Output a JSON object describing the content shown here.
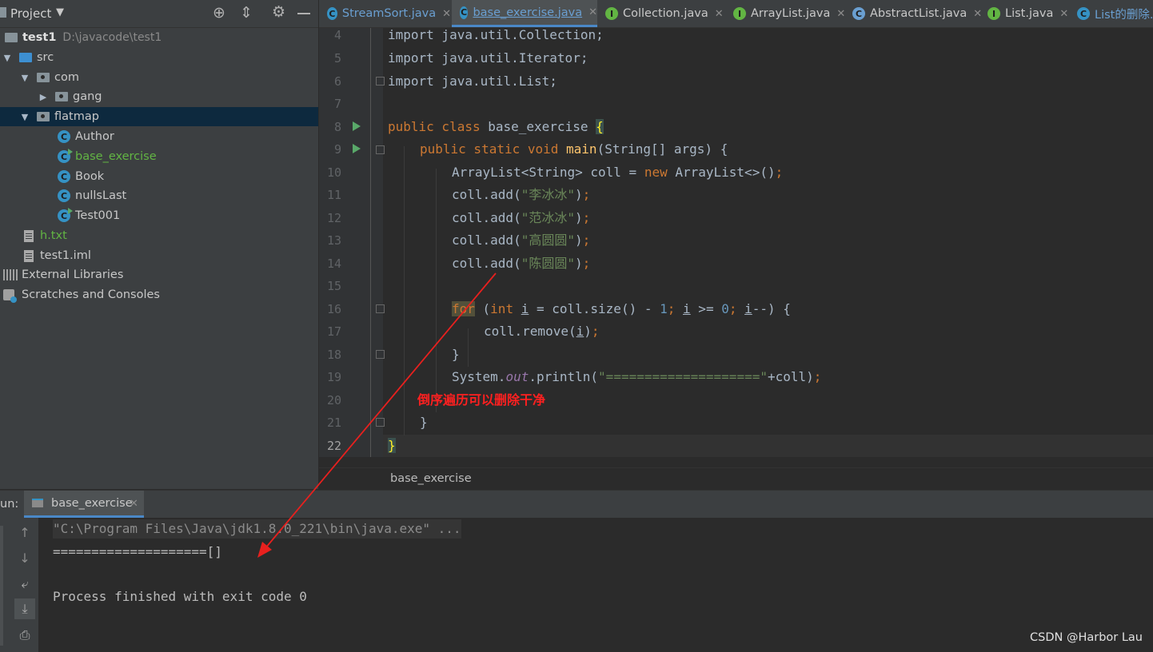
{
  "project_panel": {
    "title": "Project",
    "root": {
      "name": "test1",
      "path": "D:\\javacode\\test1"
    },
    "tree": [
      {
        "label": "src",
        "type": "src-folder",
        "depth": 1,
        "expanded": true
      },
      {
        "label": "com",
        "type": "package",
        "depth": 2,
        "expanded": true
      },
      {
        "label": "gang",
        "type": "package",
        "depth": 3,
        "expanded": false
      },
      {
        "label": "flatmap",
        "type": "package",
        "depth": 2,
        "expanded": true,
        "selected": true
      },
      {
        "label": "Author",
        "type": "class",
        "depth": 3
      },
      {
        "label": "base_exercise",
        "type": "class-run",
        "depth": 3,
        "modified": true
      },
      {
        "label": "Book",
        "type": "class",
        "depth": 3
      },
      {
        "label": "nullsLast",
        "type": "class",
        "depth": 3
      },
      {
        "label": "Test001",
        "type": "class-run",
        "depth": 3
      },
      {
        "label": "h.txt",
        "type": "file",
        "depth": 1,
        "modified": true
      },
      {
        "label": "test1.iml",
        "type": "file",
        "depth": 1
      },
      {
        "label": "External Libraries",
        "type": "libraries",
        "depth": 0
      },
      {
        "label": "Scratches and Consoles",
        "type": "scratches",
        "depth": 0
      }
    ]
  },
  "tabs": [
    {
      "label": "StreamSort.java",
      "icon": "class-icon"
    },
    {
      "label": "base_exercise.java",
      "icon": "class-icon",
      "active": true
    },
    {
      "label": "Collection.java",
      "icon": "interface-icon"
    },
    {
      "label": "ArrayList.java",
      "icon": "interface-icon"
    },
    {
      "label": "AbstractList.java",
      "icon": "abstract-class-icon"
    },
    {
      "label": "List.java",
      "icon": "interface-icon"
    },
    {
      "label": "List的删除.j",
      "icon": "class-icon"
    }
  ],
  "editor": {
    "line_numbers": [
      "4",
      "5",
      "6",
      "7",
      "8",
      "9",
      "10",
      "11",
      "12",
      "13",
      "14",
      "15",
      "16",
      "17",
      "18",
      "19",
      "20",
      "21",
      "22"
    ],
    "lines": {
      "l4": "import java.util.Collection;",
      "l5": "import java.util.Iterator;",
      "l6": "import java.util.List;",
      "l8_kw": "public class ",
      "l8_name": "base_exercise ",
      "l8_brace": "{",
      "l9_kw": "public static void ",
      "l9_fn": "main",
      "l9_rest": "(String[] args) {",
      "l10_a": "ArrayList<String> coll = ",
      "l10_kw": "new ",
      "l10_b": "ArrayList<>()",
      "l11_a": "coll.add(",
      "l11_s": "\"李冰冰\"",
      "l12_s": "\"范冰冰\"",
      "l13_s": "\"高圆圆\"",
      "l14_s": "\"陈圆圆\"",
      "close_paren": ")",
      "semi": ";",
      "l16_for": "for",
      "l16_a": " (",
      "l16_int": "int ",
      "l16_i": "i",
      "l16_b": " = coll.size() - ",
      "l16_1": "1",
      "l16_c": " >= ",
      "l16_0": "0",
      "l16_d": "--) {",
      "l17_a": "coll.remove(",
      "l18": "}",
      "l19_a": "System.",
      "l19_out": "out",
      "l19_b": ".println(",
      "l19_s": "\"====================\"",
      "l19_c": "+coll)",
      "l21": "}",
      "l22": "}"
    },
    "annotation": "倒序遍历可以删除干净",
    "breadcrumb": "base_exercise"
  },
  "run_panel": {
    "label": "un:",
    "tab": "base_exercise",
    "console": [
      "\"C:\\Program Files\\Java\\jdk1.8.0_221\\bin\\java.exe\" ...",
      "====================[]",
      "",
      "Process finished with exit code 0"
    ]
  },
  "watermark": "CSDN @Harbor Lau",
  "colors": {
    "keyword": "#cc7832",
    "string": "#6a8759",
    "number": "#6897bb",
    "function": "#ffc66d",
    "annotation": "#ff2020",
    "modified_file": "#62b543"
  }
}
